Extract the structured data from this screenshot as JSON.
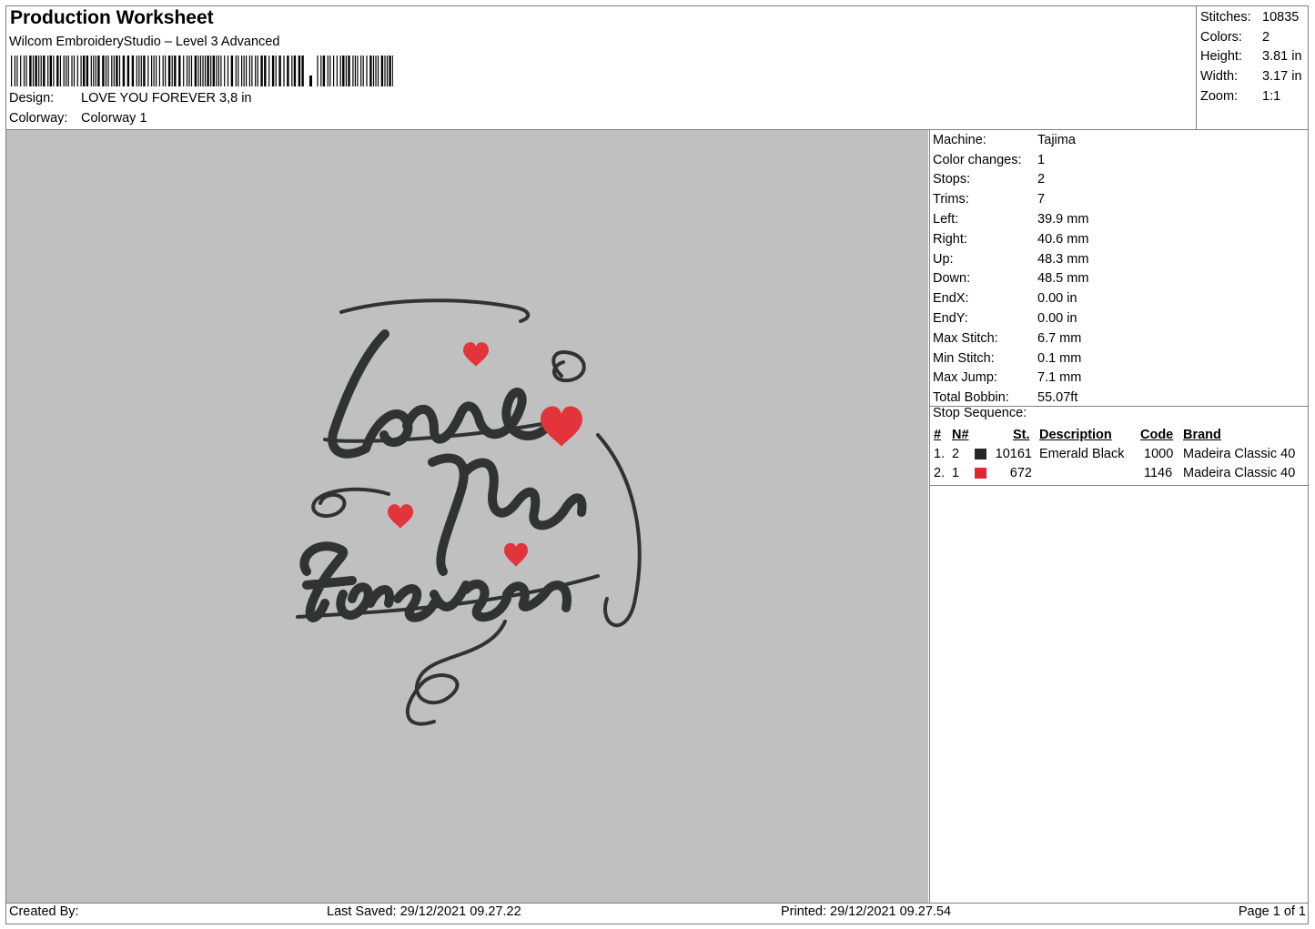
{
  "header": {
    "title": "Production Worksheet",
    "software": "Wilcom EmbroideryStudio – Level 3 Advanced",
    "design_label": "Design:",
    "design_value": "LOVE YOU FOREVER 3,8 in",
    "colorway_label": "Colorway:",
    "colorway_value": "Colorway 1"
  },
  "summary": [
    {
      "label": "Stitches:",
      "value": "10835"
    },
    {
      "label": "Colors:",
      "value": "2"
    },
    {
      "label": "Height:",
      "value": "3.81 in"
    },
    {
      "label": "Width:",
      "value": "3.17 in"
    },
    {
      "label": "Zoom:",
      "value": "1:1"
    }
  ],
  "machine_info": [
    {
      "label": "Machine:",
      "value": "Tajima"
    },
    {
      "label": "Color changes:",
      "value": "1"
    },
    {
      "label": "Stops:",
      "value": "2"
    },
    {
      "label": "Trims:",
      "value": "7"
    },
    {
      "label": "Left:",
      "value": "39.9 mm"
    },
    {
      "label": "Right:",
      "value": "40.6 mm"
    },
    {
      "label": "Up:",
      "value": "48.3 mm"
    },
    {
      "label": "Down:",
      "value": "48.5 mm"
    },
    {
      "label": "EndX:",
      "value": "0.00 in"
    },
    {
      "label": "EndY:",
      "value": "0.00 in"
    },
    {
      "label": "Max Stitch:",
      "value": "6.7 mm"
    },
    {
      "label": "Min Stitch:",
      "value": "0.1 mm"
    },
    {
      "label": "Max Jump:",
      "value": "7.1 mm"
    },
    {
      "label": "Total Bobbin:",
      "value": "55.07ft"
    }
  ],
  "stop_sequence": {
    "title": "Stop Sequence:",
    "columns": {
      "idx": "#",
      "n": "N#",
      "st": "St.",
      "desc": "Description",
      "code": "Code",
      "brand": "Brand"
    },
    "rows": [
      {
        "idx": "1.",
        "n": "2",
        "color": "#262626",
        "st": "10161",
        "desc": "Emerald Black",
        "code": "1000",
        "brand": "Madeira Classic 40"
      },
      {
        "idx": "2.",
        "n": "1",
        "color": "#e0262e",
        "st": "672",
        "desc": "",
        "code": "1146",
        "brand": "Madeira Classic 40"
      }
    ]
  },
  "design_preview": {
    "background": "#c0c0c0",
    "thread_dark": "#2f3430",
    "thread_red": "#e2343a"
  },
  "footer": {
    "created_by": "Created By:",
    "last_saved": "Last Saved: 29/12/2021 09.27.22",
    "printed": "Printed: 29/12/2021 09.27.54",
    "page": "Page 1 of 1"
  }
}
